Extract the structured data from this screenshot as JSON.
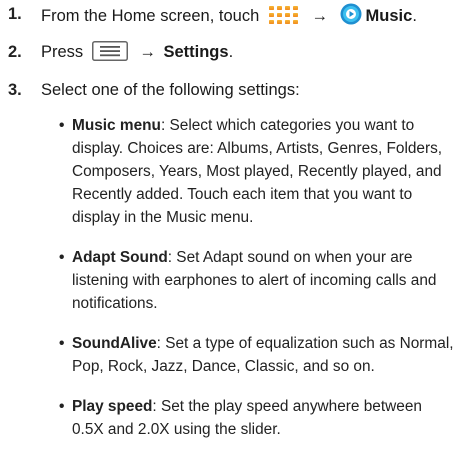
{
  "steps": [
    {
      "number": "1.",
      "parts": {
        "before": "From the Home screen, touch",
        "apps_icon": "apps-grid-icon",
        "arrow": "→",
        "music_icon": "music-app-icon",
        "app_name": "Music",
        "end": "."
      }
    },
    {
      "number": "2.",
      "parts": {
        "before": "Press",
        "menu_icon": "menu-key-icon",
        "arrow": "→",
        "label": "Settings",
        "end": "."
      }
    },
    {
      "number": "3.",
      "text": "Select one of the following settings:"
    }
  ],
  "settings": [
    {
      "term": "Music menu",
      "lines": [
        ": Select which categories you want to",
        "display. Choices are: Albums, Artists, Genres, Folders,",
        "Composers, Years, Most played, Recently played, and",
        "Recently added. Touch each item that you want to",
        "display in the Music menu."
      ]
    },
    {
      "term": "Adapt Sound",
      "lines": [
        ": Set Adapt sound on when your are",
        "listening with earphones to alert of incoming calls and",
        "notifications."
      ]
    },
    {
      "term": "SoundAlive",
      "lines": [
        ": Set a type of equalization such as Normal,",
        "Pop, Rock, Jazz, Dance, Classic, and so on."
      ]
    },
    {
      "term": "Play speed",
      "lines": [
        ": Set the play speed anywhere between",
        "0.5X and 2.0X using the slider."
      ]
    }
  ],
  "colors": {
    "icon_orange_top": "#f7b733",
    "icon_orange_bottom": "#f18a20",
    "music_icon_outer": "#1f8fd0",
    "music_icon_inner": "#3cc0f0"
  }
}
